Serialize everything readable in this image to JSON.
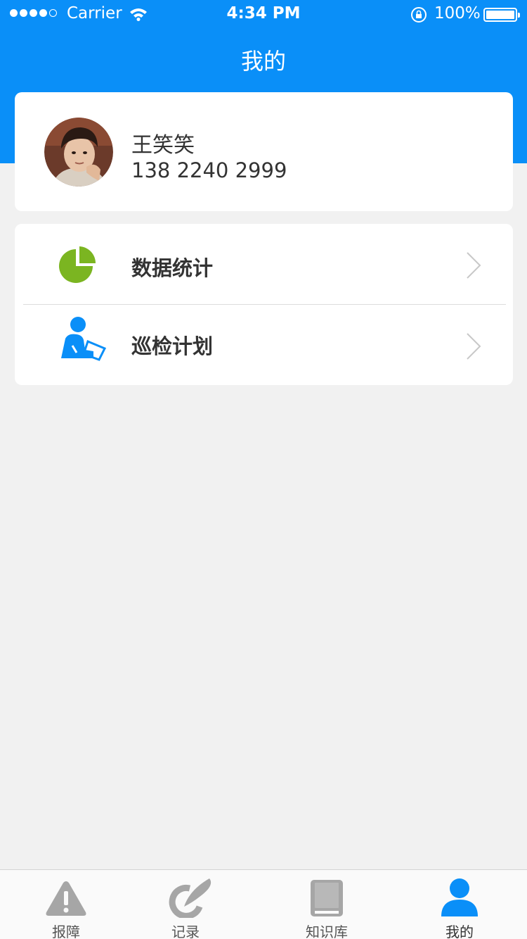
{
  "status_bar": {
    "carrier": "Carrier",
    "time": "4:34 PM",
    "battery": "100%"
  },
  "header": {
    "title": "我的",
    "color": "#0a8ff8"
  },
  "profile": {
    "name": "王笑笑",
    "phone": "138 2240 2999"
  },
  "menu": {
    "items": [
      {
        "label": "数据统计",
        "icon": "pie-chart-icon",
        "icon_color": "#7bb521"
      },
      {
        "label": "巡检计划",
        "icon": "inspector-icon",
        "icon_color": "#0a8ff8"
      }
    ]
  },
  "tabs": [
    {
      "label": "报障",
      "icon": "warning-icon",
      "active": false
    },
    {
      "label": "记录",
      "icon": "record-icon",
      "active": false
    },
    {
      "label": "知识库",
      "icon": "book-icon",
      "active": false
    },
    {
      "label": "我的",
      "icon": "user-icon",
      "active": true
    }
  ],
  "colors": {
    "tab_inactive": "#a6a6a6",
    "tab_active": "#0a8ff8"
  }
}
